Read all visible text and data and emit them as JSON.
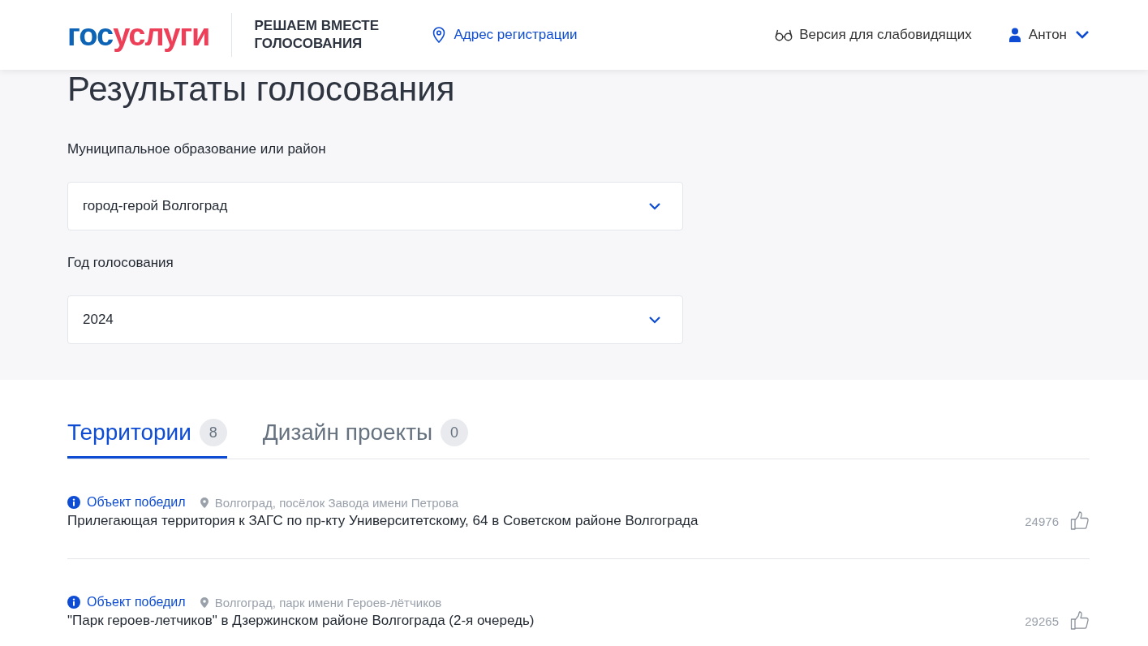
{
  "header": {
    "logo": {
      "first": "гос",
      "second": "услуги"
    },
    "tagline": "РЕШАЕМ ВМЕСТЕ ГОЛОСОВАНИЯ",
    "address_link": "Адрес регистрации",
    "accessibility_link": "Версия для слабовидящих",
    "user": "Антон"
  },
  "page_title": "Результаты голосования",
  "filters": [
    {
      "label": "Муниципальное образование или район",
      "value": "город-герой Волгоград"
    },
    {
      "label": "Год голосования",
      "value": "2024"
    }
  ],
  "tabs": [
    {
      "label": "Территории",
      "count": "8",
      "selected": true
    },
    {
      "label": "Дизайн проекты",
      "count": "0",
      "selected": false
    }
  ],
  "items": [
    {
      "status": "Объект победил",
      "location": "Волгоград, посёлок Завода имени Петрова",
      "title": "Прилегающая территория к ЗАГС по пр-кту Университетскому, 64 в Советском районе Волгограда",
      "votes": "24976"
    },
    {
      "status": "Объект победил",
      "location": "Волгоград, парк имени Героев-лётчиков",
      "title": "\"Парк героев-летчиков\" в Дзержинском районе Волгограда (2-я очередь)",
      "votes": "29265"
    }
  ]
}
